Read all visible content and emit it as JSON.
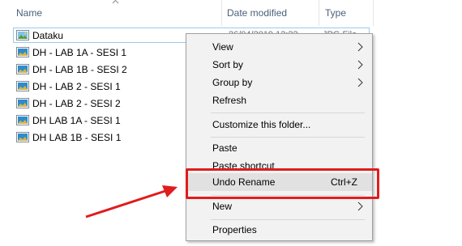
{
  "columns": {
    "name": "Name",
    "date_modified": "Date modified",
    "type": "Type"
  },
  "files": [
    {
      "name": "Dataku",
      "date": "26/04/2019 12:22",
      "type": "JPG File",
      "selected": true
    },
    {
      "name": "DH - LAB 1A - SESI 1"
    },
    {
      "name": "DH - LAB 1B - SESI 2"
    },
    {
      "name": "DH - LAB 2 - SESI 1"
    },
    {
      "name": "DH - LAB 2 - SESI 2"
    },
    {
      "name": "DH LAB 1A - SESI 1"
    },
    {
      "name": "DH LAB 1B - SESI 1"
    }
  ],
  "context_menu": {
    "view": "View",
    "sort_by": "Sort by",
    "group_by": "Group by",
    "refresh": "Refresh",
    "customize": "Customize this folder...",
    "paste": "Paste",
    "paste_shortcut": "Paste shortcut",
    "undo_rename": "Undo Rename",
    "undo_shortcut": "Ctrl+Z",
    "new": "New",
    "properties": "Properties"
  },
  "colors": {
    "highlight_box": "#e01c1c",
    "menu_bg": "#f2f2f2",
    "hover_bg": "#e1e1e1",
    "header_text": "#4c607a"
  }
}
